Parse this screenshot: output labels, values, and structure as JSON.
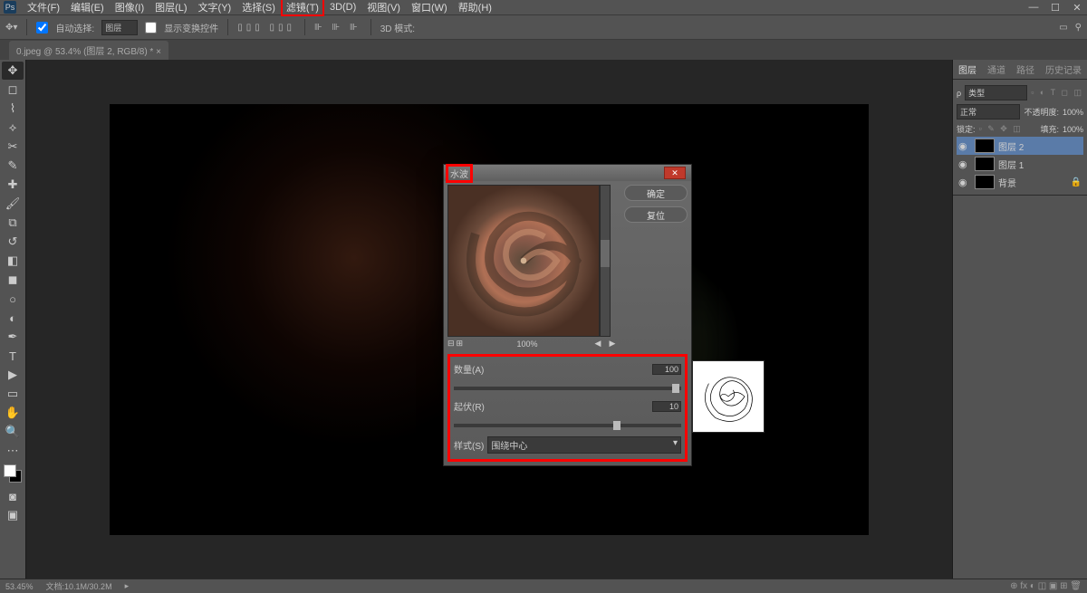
{
  "app": {
    "icon": "Ps"
  },
  "menu": {
    "items": [
      "文件(F)",
      "编辑(E)",
      "图像(I)",
      "图层(L)",
      "文字(Y)",
      "选择(S)",
      "滤镜(T)",
      "3D(D)",
      "视图(V)",
      "窗口(W)",
      "帮助(H)"
    ],
    "highlighted_index": 6
  },
  "optbar": {
    "auto_select": "自动选择:",
    "target": "图层",
    "show_transform": "显示变换控件",
    "mode3d": "3D 模式:"
  },
  "tab": {
    "title": "0.jpeg @ 53.4% (图层 2, RGB/8) *"
  },
  "panels": {
    "tabs": [
      "图层",
      "通道",
      "路径",
      "历史记录"
    ],
    "kind_label": "类型",
    "blend_mode": "正常",
    "opacity_label": "不透明度:",
    "opacity_value": "100%",
    "lock_label": "锁定:",
    "fill_label": "填充:",
    "fill_value": "100%",
    "layers": [
      {
        "name": "图层 2",
        "active": true
      },
      {
        "name": "图层 1",
        "active": false
      },
      {
        "name": "背景",
        "active": false,
        "locked": true
      }
    ]
  },
  "dialog": {
    "title": "水波",
    "zoom": "100%",
    "ok": "确定",
    "reset": "复位",
    "params": {
      "amount_label": "数量(A)",
      "amount_value": "100",
      "ridge_label": "起伏(R)",
      "ridge_value": "10",
      "style_label": "样式(S)",
      "style_value": "围绕中心"
    }
  },
  "statusbar": {
    "zoom": "53.45%",
    "doc": "文档:10.1M/30.2M"
  }
}
